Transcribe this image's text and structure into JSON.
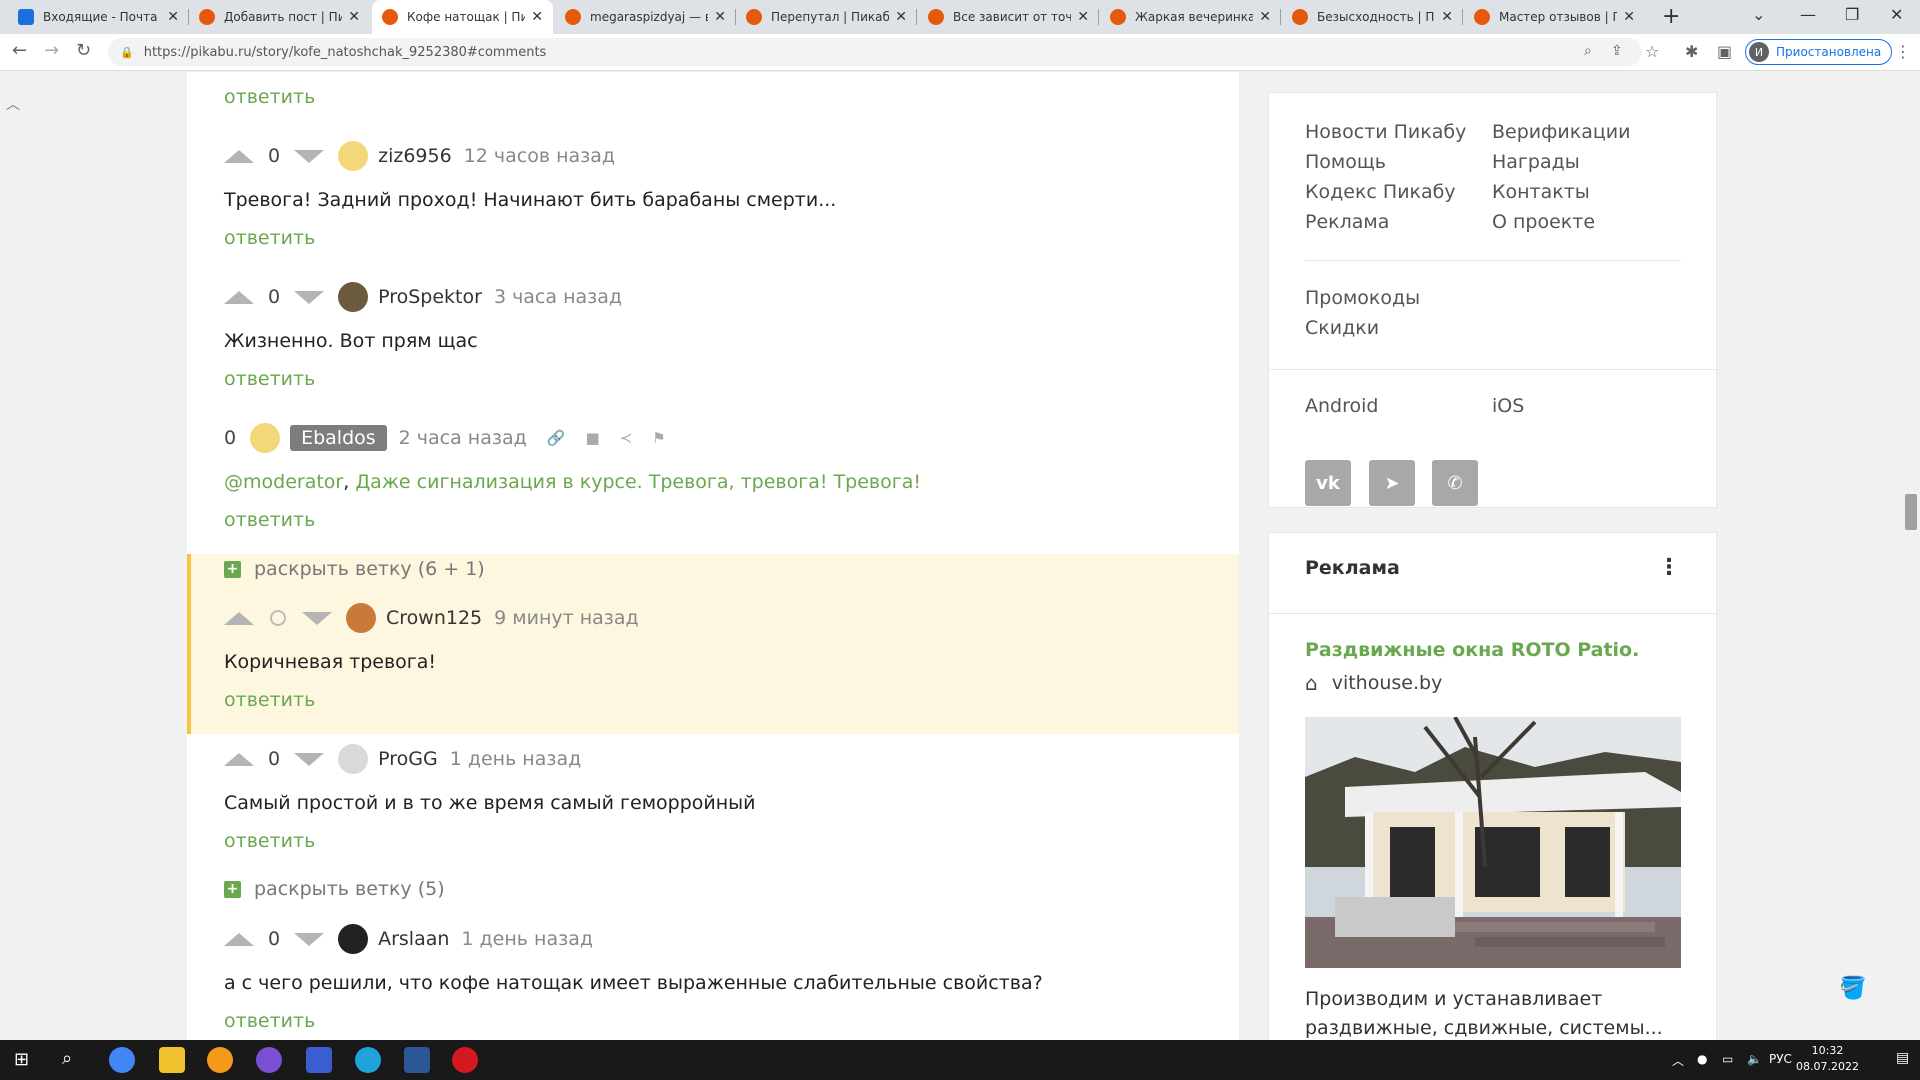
{
  "browser": {
    "tabs": [
      {
        "title": "Входящие - Почта Mail.ru",
        "favicon": "mail-icon",
        "active": false
      },
      {
        "title": "Добавить пост | Пикабу",
        "favicon": "pikabu-icon",
        "active": false
      },
      {
        "title": "Кофе натощак | Пикабу",
        "favicon": "pikabu-icon",
        "active": true
      },
      {
        "title": "megaraspizdyaj — все посты",
        "favicon": "pikabu-icon",
        "active": false
      },
      {
        "title": "Перепутал | Пикабу",
        "favicon": "pikabu-icon",
        "active": false
      },
      {
        "title": "Все зависит от точки зрения",
        "favicon": "pikabu-icon",
        "active": false
      },
      {
        "title": "Жаркая вечеринка | Пикабу",
        "favicon": "pikabu-icon",
        "active": false
      },
      {
        "title": "Безысходность | Пикабу",
        "favicon": "pikabu-icon",
        "active": false
      },
      {
        "title": "Мастер отзывов | Пикабу",
        "favicon": "pikabu-icon",
        "active": false
      }
    ],
    "url": "https://pikabu.ru/story/kofe_natoshchak_9252380#comments",
    "profile_label": "Приостановлена",
    "profile_initial": "И"
  },
  "comments": {
    "reply_label": "ответить",
    "items": [
      {
        "score": "0",
        "user": "ziz6956",
        "time": "12 часов назад",
        "text": "Тревога! Задний проход! Начинают бить барабаны смерти..."
      },
      {
        "score": "0",
        "user": "ProSpektor",
        "time": "3 часа назад",
        "text": "Жизненно. Вот прям щас"
      },
      {
        "score": "0",
        "user": "Ebaldos",
        "time": "2 часа назад",
        "mention": "@moderator",
        "text": "Даже сигнализация в курсе. Тревога, тревога! Тревога!"
      },
      {
        "expand": "раскрыть ветку (6 + 1)"
      },
      {
        "score": "",
        "user": "Crown125",
        "time": "9 минут назад",
        "text": "Коричневая тревога!"
      },
      {
        "score": "0",
        "user": "ProGG",
        "time": "1 день назад",
        "text": "Самый простой и в то же время самый геморройный"
      },
      {
        "expand": "раскрыть ветку (5)"
      },
      {
        "score": "0",
        "user": "Arslaan",
        "time": "1 день назад",
        "text": "а с чего решили, что кофе натощак имеет выраженные слабительные свойства?"
      }
    ]
  },
  "sidebar": {
    "links_col1": [
      "Новости Пикабу",
      "Помощь",
      "Кодекс Пикабу",
      "Реклама"
    ],
    "links_col2": [
      "Верификации",
      "Награды",
      "Контакты",
      "О проекте"
    ],
    "links_extra": [
      "Промокоды",
      "Скидки"
    ],
    "apps": [
      "Android",
      "iOS"
    ],
    "social": [
      "vk-icon",
      "telegram-icon",
      "viber-icon"
    ],
    "ad": {
      "heading": "Реклама",
      "title": "Раздвижные окна ROTO Patio.",
      "domain": "vithouse.by",
      "description": "Производим и устанавливает раздвижные, сдвижные, системы..."
    }
  },
  "taskbar": {
    "lang": "РУС",
    "time": "10:32",
    "date": "08.07.2022"
  },
  "colors": {
    "accent_green": "#6aa84f",
    "highlight_bg": "#fef7e0",
    "highlight_border": "#f6c343"
  }
}
